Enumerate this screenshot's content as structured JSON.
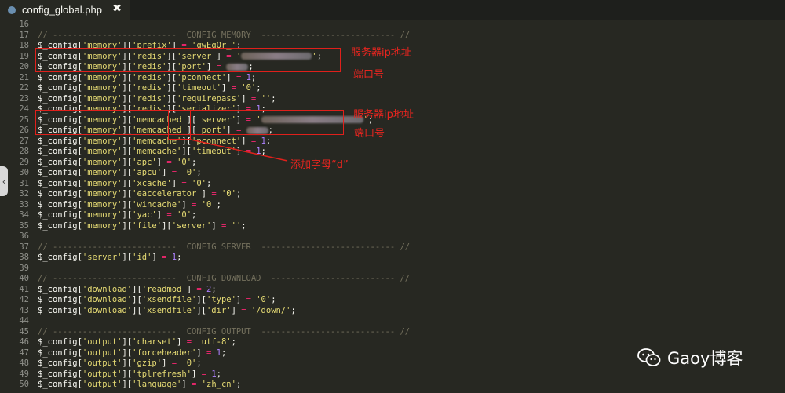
{
  "tab": {
    "title": "config_global.php",
    "close": "✖"
  },
  "scroll_handle": "‹",
  "lines": [
    {
      "n": "16",
      "parts": []
    },
    {
      "n": "17",
      "parts": [
        [
          "c",
          "// -------------------------  CONFIG MEMORY  --------------------------- //"
        ]
      ]
    },
    {
      "n": "18",
      "parts": [
        [
          "v",
          "$_config"
        ],
        [
          "p",
          "["
        ],
        [
          "s",
          "'memory'"
        ],
        [
          "p",
          "]["
        ],
        [
          "s",
          "'prefix'"
        ],
        [
          "p",
          "] "
        ],
        [
          "o",
          "="
        ],
        [
          "p",
          " "
        ],
        [
          "s",
          "'qwEgQr_'"
        ],
        [
          "p",
          ";"
        ]
      ]
    },
    {
      "n": "19",
      "parts": [
        [
          "v",
          "$_config"
        ],
        [
          "p",
          "["
        ],
        [
          "s",
          "'memory'"
        ],
        [
          "p",
          "]["
        ],
        [
          "s",
          "'redis'"
        ],
        [
          "p",
          "]["
        ],
        [
          "s",
          "'server'"
        ],
        [
          "p",
          "] "
        ],
        [
          "o",
          "="
        ],
        [
          "p",
          " "
        ],
        [
          "s",
          "'"
        ],
        [
          "b",
          "90"
        ],
        [
          "s",
          "'"
        ],
        [
          "p",
          ";"
        ]
      ]
    },
    {
      "n": "20",
      "parts": [
        [
          "v",
          "$_config"
        ],
        [
          "p",
          "["
        ],
        [
          "s",
          "'memory'"
        ],
        [
          "p",
          "]["
        ],
        [
          "s",
          "'redis'"
        ],
        [
          "p",
          "]["
        ],
        [
          "s",
          "'port'"
        ],
        [
          "p",
          "] "
        ],
        [
          "o",
          "="
        ],
        [
          "p",
          " "
        ],
        [
          "b",
          "28"
        ],
        [
          "p",
          ";"
        ]
      ]
    },
    {
      "n": "21",
      "parts": [
        [
          "v",
          "$_config"
        ],
        [
          "p",
          "["
        ],
        [
          "s",
          "'memory'"
        ],
        [
          "p",
          "]["
        ],
        [
          "s",
          "'redis'"
        ],
        [
          "p",
          "]["
        ],
        [
          "s",
          "'pconnect'"
        ],
        [
          "p",
          "] "
        ],
        [
          "o",
          "="
        ],
        [
          "p",
          " "
        ],
        [
          "n",
          "1"
        ],
        [
          "p",
          ";"
        ]
      ]
    },
    {
      "n": "22",
      "parts": [
        [
          "v",
          "$_config"
        ],
        [
          "p",
          "["
        ],
        [
          "s",
          "'memory'"
        ],
        [
          "p",
          "]["
        ],
        [
          "s",
          "'redis'"
        ],
        [
          "p",
          "]["
        ],
        [
          "s",
          "'timeout'"
        ],
        [
          "p",
          "] "
        ],
        [
          "o",
          "="
        ],
        [
          "p",
          " "
        ],
        [
          "s",
          "'0'"
        ],
        [
          "p",
          ";"
        ]
      ]
    },
    {
      "n": "23",
      "parts": [
        [
          "v",
          "$_config"
        ],
        [
          "p",
          "["
        ],
        [
          "s",
          "'memory'"
        ],
        [
          "p",
          "]["
        ],
        [
          "s",
          "'redis'"
        ],
        [
          "p",
          "]["
        ],
        [
          "s",
          "'requirepass'"
        ],
        [
          "p",
          "] "
        ],
        [
          "o",
          "="
        ],
        [
          "p",
          " "
        ],
        [
          "s",
          "''"
        ],
        [
          "p",
          ";"
        ]
      ]
    },
    {
      "n": "24",
      "parts": [
        [
          "v",
          "$_config"
        ],
        [
          "p",
          "["
        ],
        [
          "s",
          "'memory'"
        ],
        [
          "p",
          "]["
        ],
        [
          "s",
          "'redis'"
        ],
        [
          "p",
          "]["
        ],
        [
          "s",
          "'serializer'"
        ],
        [
          "p",
          "] "
        ],
        [
          "o",
          "="
        ],
        [
          "p",
          " "
        ],
        [
          "n",
          "1"
        ],
        [
          "p",
          ";"
        ]
      ]
    },
    {
      "n": "25",
      "parts": [
        [
          "v",
          "$_config"
        ],
        [
          "p",
          "["
        ],
        [
          "s",
          "'memory'"
        ],
        [
          "p",
          "]["
        ],
        [
          "s",
          "'memcached'"
        ],
        [
          "p",
          "]["
        ],
        [
          "s",
          "'server'"
        ],
        [
          "p",
          "] "
        ],
        [
          "o",
          "="
        ],
        [
          "p",
          " "
        ],
        [
          "s",
          "'"
        ],
        [
          "b",
          "130"
        ],
        [
          "s",
          "'"
        ],
        [
          "p",
          ";"
        ]
      ]
    },
    {
      "n": "26",
      "parts": [
        [
          "v",
          "$_config"
        ],
        [
          "p",
          "["
        ],
        [
          "s",
          "'memory'"
        ],
        [
          "p",
          "]["
        ],
        [
          "s",
          "'memcached'"
        ],
        [
          "p",
          "]["
        ],
        [
          "s",
          "'port'"
        ],
        [
          "p",
          "] "
        ],
        [
          "o",
          "="
        ],
        [
          "p",
          " "
        ],
        [
          "b",
          "28"
        ],
        [
          "p",
          ";"
        ]
      ]
    },
    {
      "n": "27",
      "parts": [
        [
          "v",
          "$_config"
        ],
        [
          "p",
          "["
        ],
        [
          "s",
          "'memory'"
        ],
        [
          "p",
          "]["
        ],
        [
          "s",
          "'memcache'"
        ],
        [
          "p",
          "]["
        ],
        [
          "s",
          "'pconnect'"
        ],
        [
          "p",
          "] "
        ],
        [
          "o",
          "="
        ],
        [
          "p",
          " "
        ],
        [
          "n",
          "1"
        ],
        [
          "p",
          ";"
        ]
      ]
    },
    {
      "n": "28",
      "parts": [
        [
          "v",
          "$_config"
        ],
        [
          "p",
          "["
        ],
        [
          "s",
          "'memory'"
        ],
        [
          "p",
          "]["
        ],
        [
          "s",
          "'memcache'"
        ],
        [
          "p",
          "]["
        ],
        [
          "s",
          "'timeout'"
        ],
        [
          "p",
          "] "
        ],
        [
          "o",
          "="
        ],
        [
          "p",
          " "
        ],
        [
          "n",
          "1"
        ],
        [
          "p",
          ";"
        ]
      ]
    },
    {
      "n": "29",
      "parts": [
        [
          "v",
          "$_config"
        ],
        [
          "p",
          "["
        ],
        [
          "s",
          "'memory'"
        ],
        [
          "p",
          "]["
        ],
        [
          "s",
          "'apc'"
        ],
        [
          "p",
          "] "
        ],
        [
          "o",
          "="
        ],
        [
          "p",
          " "
        ],
        [
          "s",
          "'0'"
        ],
        [
          "p",
          ";"
        ]
      ]
    },
    {
      "n": "30",
      "parts": [
        [
          "v",
          "$_config"
        ],
        [
          "p",
          "["
        ],
        [
          "s",
          "'memory'"
        ],
        [
          "p",
          "]["
        ],
        [
          "s",
          "'apcu'"
        ],
        [
          "p",
          "] "
        ],
        [
          "o",
          "="
        ],
        [
          "p",
          " "
        ],
        [
          "s",
          "'0'"
        ],
        [
          "p",
          ";"
        ]
      ]
    },
    {
      "n": "31",
      "parts": [
        [
          "v",
          "$_config"
        ],
        [
          "p",
          "["
        ],
        [
          "s",
          "'memory'"
        ],
        [
          "p",
          "]["
        ],
        [
          "s",
          "'xcache'"
        ],
        [
          "p",
          "] "
        ],
        [
          "o",
          "="
        ],
        [
          "p",
          " "
        ],
        [
          "s",
          "'0'"
        ],
        [
          "p",
          ";"
        ]
      ]
    },
    {
      "n": "32",
      "parts": [
        [
          "v",
          "$_config"
        ],
        [
          "p",
          "["
        ],
        [
          "s",
          "'memory'"
        ],
        [
          "p",
          "]["
        ],
        [
          "s",
          "'eaccelerator'"
        ],
        [
          "p",
          "] "
        ],
        [
          "o",
          "="
        ],
        [
          "p",
          " "
        ],
        [
          "s",
          "'0'"
        ],
        [
          "p",
          ";"
        ]
      ]
    },
    {
      "n": "33",
      "parts": [
        [
          "v",
          "$_config"
        ],
        [
          "p",
          "["
        ],
        [
          "s",
          "'memory'"
        ],
        [
          "p",
          "]["
        ],
        [
          "s",
          "'wincache'"
        ],
        [
          "p",
          "] "
        ],
        [
          "o",
          "="
        ],
        [
          "p",
          " "
        ],
        [
          "s",
          "'0'"
        ],
        [
          "p",
          ";"
        ]
      ]
    },
    {
      "n": "34",
      "parts": [
        [
          "v",
          "$_config"
        ],
        [
          "p",
          "["
        ],
        [
          "s",
          "'memory'"
        ],
        [
          "p",
          "]["
        ],
        [
          "s",
          "'yac'"
        ],
        [
          "p",
          "] "
        ],
        [
          "o",
          "="
        ],
        [
          "p",
          " "
        ],
        [
          "s",
          "'0'"
        ],
        [
          "p",
          ";"
        ]
      ]
    },
    {
      "n": "35",
      "parts": [
        [
          "v",
          "$_config"
        ],
        [
          "p",
          "["
        ],
        [
          "s",
          "'memory'"
        ],
        [
          "p",
          "]["
        ],
        [
          "s",
          "'file'"
        ],
        [
          "p",
          "]["
        ],
        [
          "s",
          "'server'"
        ],
        [
          "p",
          "] "
        ],
        [
          "o",
          "="
        ],
        [
          "p",
          " "
        ],
        [
          "s",
          "''"
        ],
        [
          "p",
          ";"
        ]
      ]
    },
    {
      "n": "36",
      "parts": []
    },
    {
      "n": "37",
      "parts": [
        [
          "c",
          "// -------------------------  CONFIG SERVER  --------------------------- //"
        ]
      ]
    },
    {
      "n": "38",
      "parts": [
        [
          "v",
          "$_config"
        ],
        [
          "p",
          "["
        ],
        [
          "s",
          "'server'"
        ],
        [
          "p",
          "]["
        ],
        [
          "s",
          "'id'"
        ],
        [
          "p",
          "] "
        ],
        [
          "o",
          "="
        ],
        [
          "p",
          " "
        ],
        [
          "n",
          "1"
        ],
        [
          "p",
          ";"
        ]
      ]
    },
    {
      "n": "39",
      "parts": []
    },
    {
      "n": "40",
      "parts": [
        [
          "c",
          "// -------------------------  CONFIG DOWNLOAD  ------------------------- //"
        ]
      ]
    },
    {
      "n": "41",
      "parts": [
        [
          "v",
          "$_config"
        ],
        [
          "p",
          "["
        ],
        [
          "s",
          "'download'"
        ],
        [
          "p",
          "]["
        ],
        [
          "s",
          "'readmod'"
        ],
        [
          "p",
          "] "
        ],
        [
          "o",
          "="
        ],
        [
          "p",
          " "
        ],
        [
          "n",
          "2"
        ],
        [
          "p",
          ";"
        ]
      ]
    },
    {
      "n": "42",
      "parts": [
        [
          "v",
          "$_config"
        ],
        [
          "p",
          "["
        ],
        [
          "s",
          "'download'"
        ],
        [
          "p",
          "]["
        ],
        [
          "s",
          "'xsendfile'"
        ],
        [
          "p",
          "]["
        ],
        [
          "s",
          "'type'"
        ],
        [
          "p",
          "] "
        ],
        [
          "o",
          "="
        ],
        [
          "p",
          " "
        ],
        [
          "s",
          "'0'"
        ],
        [
          "p",
          ";"
        ]
      ]
    },
    {
      "n": "43",
      "parts": [
        [
          "v",
          "$_config"
        ],
        [
          "p",
          "["
        ],
        [
          "s",
          "'download'"
        ],
        [
          "p",
          "]["
        ],
        [
          "s",
          "'xsendfile'"
        ],
        [
          "p",
          "]["
        ],
        [
          "s",
          "'dir'"
        ],
        [
          "p",
          "] "
        ],
        [
          "o",
          "="
        ],
        [
          "p",
          " "
        ],
        [
          "s",
          "'/down/'"
        ],
        [
          "p",
          ";"
        ]
      ]
    },
    {
      "n": "44",
      "parts": []
    },
    {
      "n": "45",
      "parts": [
        [
          "c",
          "// -------------------------  CONFIG OUTPUT  --------------------------- //"
        ]
      ]
    },
    {
      "n": "46",
      "parts": [
        [
          "v",
          "$_config"
        ],
        [
          "p",
          "["
        ],
        [
          "s",
          "'output'"
        ],
        [
          "p",
          "]["
        ],
        [
          "s",
          "'charset'"
        ],
        [
          "p",
          "] "
        ],
        [
          "o",
          "="
        ],
        [
          "p",
          " "
        ],
        [
          "s",
          "'utf-8'"
        ],
        [
          "p",
          ";"
        ]
      ]
    },
    {
      "n": "47",
      "parts": [
        [
          "v",
          "$_config"
        ],
        [
          "p",
          "["
        ],
        [
          "s",
          "'output'"
        ],
        [
          "p",
          "]["
        ],
        [
          "s",
          "'forceheader'"
        ],
        [
          "p",
          "] "
        ],
        [
          "o",
          "="
        ],
        [
          "p",
          " "
        ],
        [
          "n",
          "1"
        ],
        [
          "p",
          ";"
        ]
      ]
    },
    {
      "n": "48",
      "parts": [
        [
          "v",
          "$_config"
        ],
        [
          "p",
          "["
        ],
        [
          "s",
          "'output'"
        ],
        [
          "p",
          "]["
        ],
        [
          "s",
          "'gzip'"
        ],
        [
          "p",
          "] "
        ],
        [
          "o",
          "="
        ],
        [
          "p",
          " "
        ],
        [
          "s",
          "'0'"
        ],
        [
          "p",
          ";"
        ]
      ]
    },
    {
      "n": "49",
      "parts": [
        [
          "v",
          "$_config"
        ],
        [
          "p",
          "["
        ],
        [
          "s",
          "'output'"
        ],
        [
          "p",
          "]["
        ],
        [
          "s",
          "'tplrefresh'"
        ],
        [
          "p",
          "] "
        ],
        [
          "o",
          "="
        ],
        [
          "p",
          " "
        ],
        [
          "n",
          "1"
        ],
        [
          "p",
          ";"
        ]
      ]
    },
    {
      "n": "50",
      "parts": [
        [
          "v",
          "$_config"
        ],
        [
          "p",
          "["
        ],
        [
          "s",
          "'output'"
        ],
        [
          "p",
          "]["
        ],
        [
          "s",
          "'language'"
        ],
        [
          "p",
          "] "
        ],
        [
          "o",
          "="
        ],
        [
          "p",
          " "
        ],
        [
          "s",
          "'zh_cn'"
        ],
        [
          "p",
          ";"
        ]
      ]
    }
  ],
  "annotations": {
    "server_ip_1": "服务器ip地址",
    "port_1": "端口号",
    "server_ip_2": "服务器ip地址",
    "port_2": "端口号",
    "add_letter": "添加字母“d”"
  },
  "watermark": {
    "text": "Gaoy博客",
    "icon": "wechat-icon"
  },
  "colors": {
    "background": "#272822",
    "annotation": "#e0201b",
    "string": "#e6db74",
    "number": "#ae81ff",
    "operator": "#f92672",
    "comment": "#75715e"
  }
}
